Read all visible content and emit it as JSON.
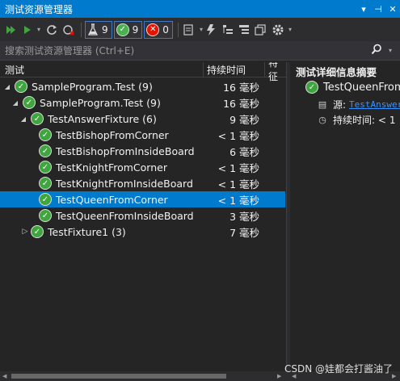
{
  "window": {
    "title": "测试资源管理器"
  },
  "toolbar": {
    "filters": {
      "total": "9",
      "passed": "9",
      "failed": "0"
    }
  },
  "search": {
    "placeholder": "搜索测试资源管理器 (Ctrl+E)"
  },
  "columns": {
    "test": "测试",
    "duration": "持续时间",
    "traits": "特征"
  },
  "tests": [
    {
      "name": "SampleProgram.Test (9)",
      "duration": "16 毫秒",
      "expanded": true
    },
    {
      "name": "SampleProgram.Test (9)",
      "duration": "16 毫秒",
      "expanded": true
    },
    {
      "name": "TestAnswerFixture (6)",
      "duration": "9 毫秒",
      "expanded": true
    },
    {
      "name": "TestBishopFromCorner",
      "duration": "< 1 毫秒"
    },
    {
      "name": "TestBishopFromInsideBoard",
      "duration": "6 毫秒"
    },
    {
      "name": "TestKnightFromCorner",
      "duration": "< 1 毫秒"
    },
    {
      "name": "TestKnightFromInsideBoard",
      "duration": "< 1 毫秒"
    },
    {
      "name": "TestQueenFromCorner",
      "duration": "< 1 毫秒",
      "selected": true
    },
    {
      "name": "TestQueenFromInsideBoard",
      "duration": "3 毫秒"
    },
    {
      "name": "TestFixture1 (3)",
      "duration": "7 毫秒",
      "expanded": false
    }
  ],
  "detail": {
    "header": "测试详细信息摘要",
    "test_name": "TestQueenFrom",
    "source_label": "源:",
    "source_value": "TestAnswer",
    "duration_label": "持续时间: <",
    "duration_value": "1"
  },
  "watermark": "CSDN @娃都会打酱油了",
  "colors": {
    "accent": "#007acc",
    "pass": "#3fa63f",
    "fail": "#e51400",
    "link": "#3794ff"
  }
}
